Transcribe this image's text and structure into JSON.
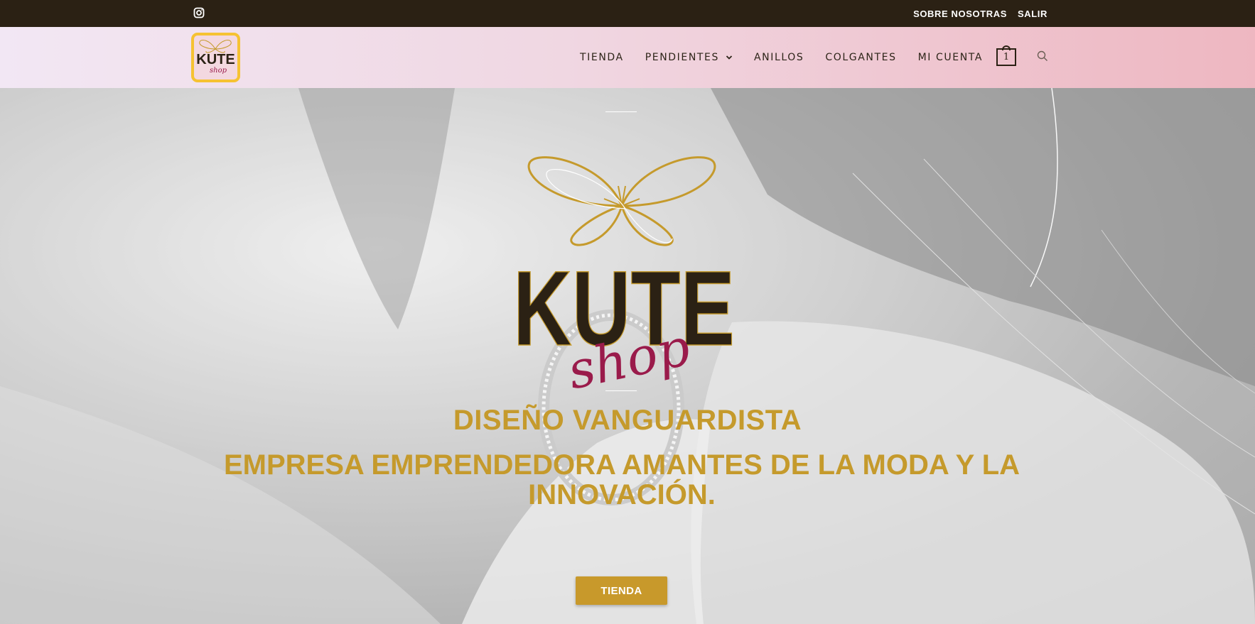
{
  "topbar": {
    "icon": "instagram-icon",
    "links": [
      "SOBRE NOSOTRAS",
      "SALIR"
    ]
  },
  "header": {
    "logo_text": "KUTE",
    "logo_script": "shop",
    "nav": [
      "TIENDA",
      "PENDIENTES",
      "ANILLOS",
      "COLGANTES",
      "MI CUENTA"
    ],
    "cart_count": "1",
    "icons": [
      "chevron-down-icon",
      "cart-icon",
      "search-icon"
    ]
  },
  "hero": {
    "logo_text": "KUTE",
    "logo_script": "shop",
    "heading": "DISEÑO VANGUARDISTA",
    "subheading": "EMPRESA EMPRENDEDORA AMANTES DE LA MODA Y LA INNOVACIÓN.",
    "button": "TIENDA"
  },
  "colors": {
    "topbar": "#2b2114",
    "gold": "#c59a2c",
    "button": "#c8992b",
    "script": "#9a1b4b",
    "logo_border": "#f6c232"
  }
}
